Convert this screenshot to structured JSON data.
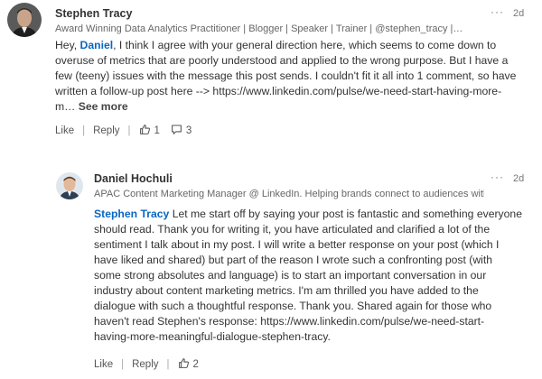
{
  "comment1": {
    "author": "Stephen Tracy",
    "headline": "Award Winning Data Analytics Practitioner | Blogger | Speaker | Trainer | @stephen_tracy |…",
    "more": "···",
    "age": "2d",
    "lines": [
      {
        "prefix": "Hey, ",
        "mention": "Daniel",
        "rest": ", I think I agree with your general direction here, which seems to come down to"
      },
      {
        "text": "overuse of metrics that are poorly understood and applied to the wrong purpose. But I have a"
      },
      {
        "text": "few (teeny) issues with the message this post sends. I couldn't fit it all into 1 comment, so have"
      },
      {
        "text": "written a follow-up post here --> https://www.linkedin.com/pulse/we-need-start-having-more-"
      },
      {
        "text": "m…",
        "see_more": " See more"
      }
    ],
    "like_label": "Like",
    "reply_label": "Reply",
    "like_count": "1",
    "reply_count": "3"
  },
  "comment2": {
    "author": "Daniel Hochuli",
    "headline": "APAC Content Marketing Manager @ LinkedIn. Helping brands connect to audiences with…",
    "more": "···",
    "age": "2d",
    "lines": [
      {
        "mention": "Stephen Tracy",
        "rest": " Let me start off by saying your post is fantastic and something everyone"
      },
      {
        "text": "should read. Thank you for writing it, you have articulated and clarified a lot of the"
      },
      {
        "text": "sentiment I talk about in my post. I will write a better response on your post (which I"
      },
      {
        "text": "have liked and shared) but part of the reason I wrote such a confronting post (with"
      },
      {
        "text": "some strong absolutes and language) is to start an important conversation in our"
      },
      {
        "text": "industry about content marketing metrics. I'm am thrilled you have added to the"
      },
      {
        "text": "dialogue with such a thoughtful response. Thank you. Shared again for those who"
      },
      {
        "text": "haven't read Stephen's response: https://www.linkedin.com/pulse/we-need-start-"
      },
      {
        "text": "having-more-meaningful-dialogue-stephen-tracy."
      }
    ],
    "like_label": "Like",
    "reply_label": "Reply",
    "like_count": "2"
  }
}
